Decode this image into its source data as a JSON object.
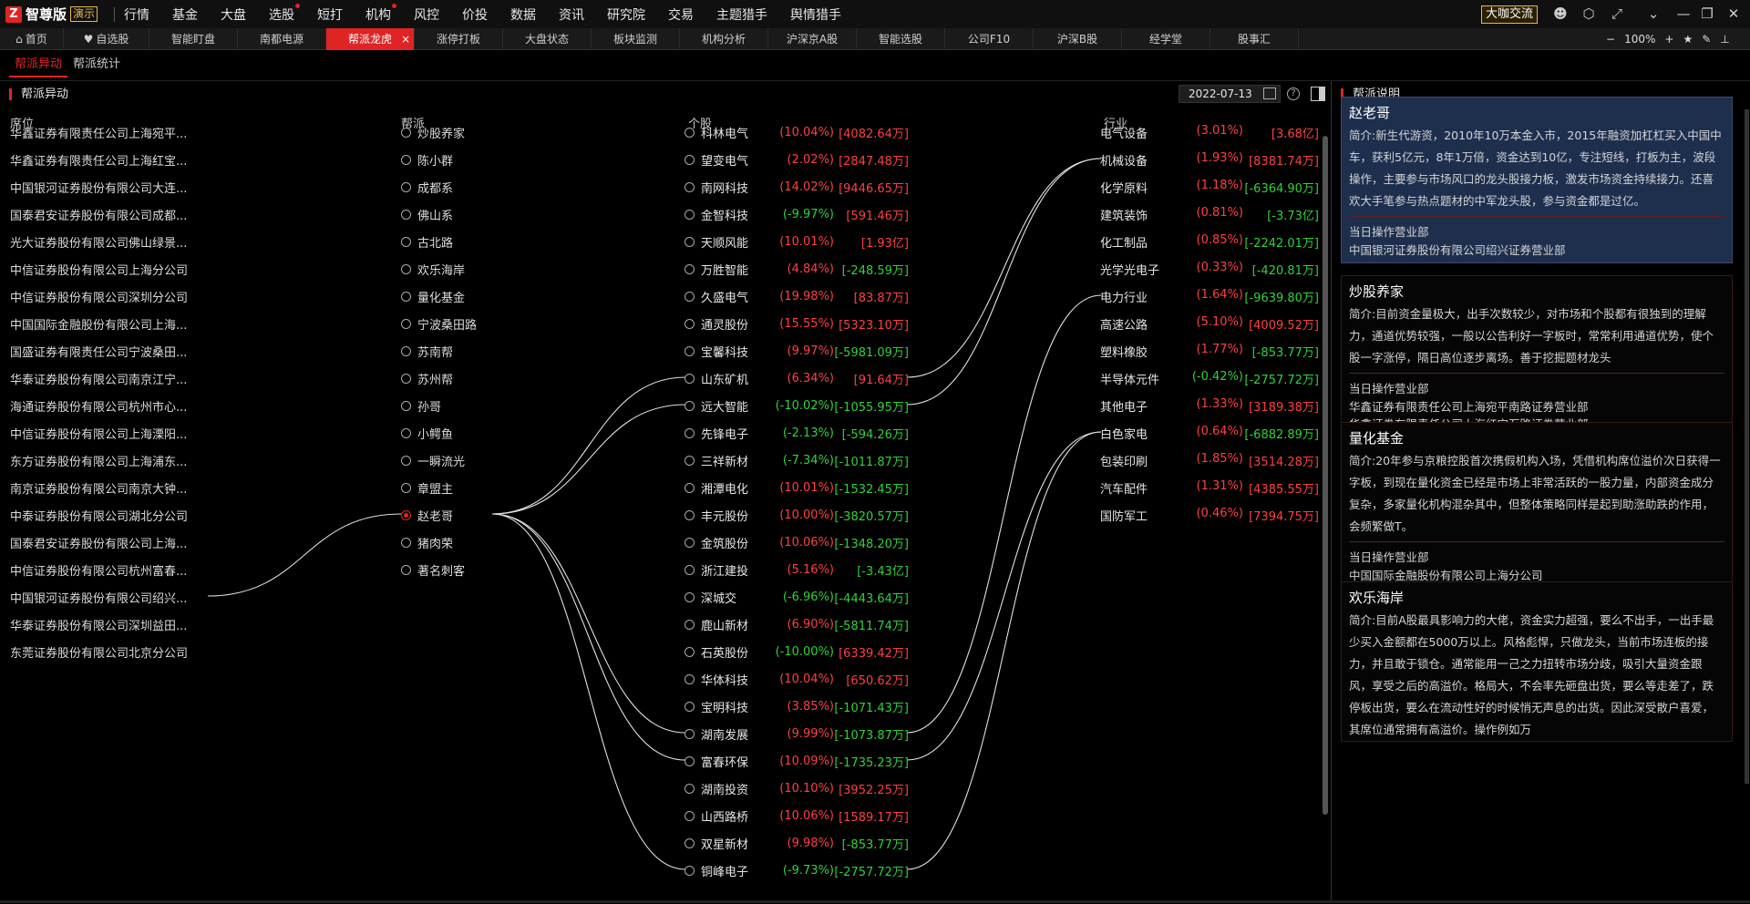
{
  "app": {
    "logo_mark": "Z",
    "name": "智尊版",
    "badge": "演示",
    "menus": [
      {
        "label": "行情",
        "dot": false
      },
      {
        "label": "基金",
        "dot": false
      },
      {
        "label": "大盘",
        "dot": false
      },
      {
        "label": "选股",
        "dot": true
      },
      {
        "label": "短打",
        "dot": false
      },
      {
        "label": "机构",
        "dot": true
      },
      {
        "label": "风控",
        "dot": false
      },
      {
        "label": "价投",
        "dot": false
      },
      {
        "label": "数据",
        "dot": false
      },
      {
        "label": "资讯",
        "dot": false
      },
      {
        "label": "研究院",
        "dot": false
      },
      {
        "label": "交易",
        "dot": false
      },
      {
        "label": "主题猎手",
        "dot": false
      },
      {
        "label": "舆情猎手",
        "dot": false
      }
    ],
    "daka_button": "大咖交流",
    "window_icons": [
      "user-icon",
      "settings-icon",
      "shrink-icon",
      "chevron-down-icon",
      "minimize-icon",
      "restore-icon",
      "close-icon"
    ]
  },
  "tabs": [
    {
      "label": "首页",
      "icon": "home-icon",
      "w": 118
    },
    {
      "label": "自选股",
      "icon": "heart-icon",
      "w": 118
    },
    {
      "label": "智能盯盘",
      "w": 118
    },
    {
      "label": "南都电源",
      "w": 118
    },
    {
      "label": "帮派龙虎",
      "active": true,
      "close": "×",
      "w": 118
    },
    {
      "label": "涨停打板",
      "w": 118
    },
    {
      "label": "大盘状态",
      "w": 118
    },
    {
      "label": "板块监测",
      "w": 118
    },
    {
      "label": "机构分析",
      "w": 118
    },
    {
      "label": "沪深京A股",
      "w": 118
    },
    {
      "label": "智能选股",
      "w": 118
    },
    {
      "label": "公司F10",
      "w": 118
    },
    {
      "label": "沪深B股",
      "w": 118
    },
    {
      "label": "经学堂",
      "w": 118
    },
    {
      "label": "股事汇",
      "w": 118
    }
  ],
  "zoom": {
    "minus": "−",
    "value": "100%",
    "plus": "+"
  },
  "subtabs": [
    {
      "label": "帮派异动",
      "active": true
    },
    {
      "label": "帮派统计",
      "active": false
    }
  ],
  "left_panel": {
    "title": "帮派异动",
    "date": "2022-07-13",
    "columns": {
      "seat": "席位",
      "gang": "帮派",
      "stock": "个股",
      "industry": "行业"
    },
    "seats": [
      "华鑫证券有限责任公司上海宛平...",
      "华鑫证券有限责任公司上海红宝...",
      "中国银河证券股份有限公司大连...",
      "国泰君安证券股份有限公司成都...",
      "光大证券股份有限公司佛山绿景...",
      "中信证券股份有限公司上海分公司",
      "中信证券股份有限公司深圳分公司",
      "中国国际金融股份有限公司上海...",
      "国盛证券有限责任公司宁波桑田...",
      "华泰证券股份有限公司南京江宁...",
      "海通证券股份有限公司杭州市心...",
      "中信证券股份有限公司上海溧阳...",
      "东方证券股份有限公司上海浦东...",
      "南京证券股份有限公司南京大钟...",
      "中泰证券股份有限公司湖北分公司",
      "国泰君安证券股份有限公司上海...",
      "中信证券股份有限公司杭州富春...",
      "中国银河证券股份有限公司绍兴...",
      "华泰证券股份有限公司深圳益田...",
      "东莞证券股份有限公司北京分公司"
    ],
    "gangs": [
      {
        "name": "炒股养家",
        "selected": false
      },
      {
        "name": "陈小群",
        "selected": false
      },
      {
        "name": "成都系",
        "selected": false
      },
      {
        "name": "佛山系",
        "selected": false
      },
      {
        "name": "古北路",
        "selected": false
      },
      {
        "name": "欢乐海岸",
        "selected": false
      },
      {
        "name": "量化基金",
        "selected": false
      },
      {
        "name": "宁波桑田路",
        "selected": false
      },
      {
        "name": "苏南帮",
        "selected": false
      },
      {
        "name": "苏州帮",
        "selected": false
      },
      {
        "name": "孙哥",
        "selected": false
      },
      {
        "name": "小鳄鱼",
        "selected": false
      },
      {
        "name": "一瞬流光",
        "selected": false
      },
      {
        "name": "章盟主",
        "selected": false
      },
      {
        "name": "赵老哥",
        "selected": true
      },
      {
        "name": "猪肉荣",
        "selected": false
      },
      {
        "name": "著名刺客",
        "selected": false
      }
    ],
    "stocks": [
      {
        "name": "科林电气",
        "pct": "(10.04%)",
        "amt": "[4082.64万]",
        "pct_up": true,
        "amt_up": true
      },
      {
        "name": "望变电气",
        "pct": "(2.02%)",
        "amt": "[2847.48万]",
        "pct_up": true,
        "amt_up": true
      },
      {
        "name": "南网科技",
        "pct": "(14.02%)",
        "amt": "[9446.65万]",
        "pct_up": true,
        "amt_up": true
      },
      {
        "name": "金智科技",
        "pct": "(-9.97%)",
        "amt": "[591.46万]",
        "pct_up": false,
        "amt_up": true
      },
      {
        "name": "天顺风能",
        "pct": "(10.01%)",
        "amt": "[1.93亿]",
        "pct_up": true,
        "amt_up": true
      },
      {
        "name": "万胜智能",
        "pct": "(4.84%)",
        "amt": "[-248.59万]",
        "pct_up": true,
        "amt_up": false
      },
      {
        "name": "久盛电气",
        "pct": "(19.98%)",
        "amt": "[83.87万]",
        "pct_up": true,
        "amt_up": true
      },
      {
        "name": "通灵股份",
        "pct": "(15.55%)",
        "amt": "[5323.10万]",
        "pct_up": true,
        "amt_up": true
      },
      {
        "name": "宝馨科技",
        "pct": "(9.97%)",
        "amt": "[-5981.09万]",
        "pct_up": true,
        "amt_up": false
      },
      {
        "name": "山东矿机",
        "pct": "(6.34%)",
        "amt": "[91.64万]",
        "pct_up": true,
        "amt_up": true
      },
      {
        "name": "远大智能",
        "pct": "(-10.02%)",
        "amt": "[-1055.95万]",
        "pct_up": false,
        "amt_up": false
      },
      {
        "name": "先锋电子",
        "pct": "(-2.13%)",
        "amt": "[-594.26万]",
        "pct_up": false,
        "amt_up": false
      },
      {
        "name": "三祥新材",
        "pct": "(-7.34%)",
        "amt": "[-1011.87万]",
        "pct_up": false,
        "amt_up": false
      },
      {
        "name": "湘潭电化",
        "pct": "(10.01%)",
        "amt": "[-1532.45万]",
        "pct_up": true,
        "amt_up": false
      },
      {
        "name": "丰元股份",
        "pct": "(10.00%)",
        "amt": "[-3820.57万]",
        "pct_up": true,
        "amt_up": false
      },
      {
        "name": "金筑股份",
        "pct": "(10.06%)",
        "amt": "[-1348.20万]",
        "pct_up": true,
        "amt_up": false
      },
      {
        "name": "浙江建投",
        "pct": "(5.16%)",
        "amt": "[-3.43亿]",
        "pct_up": true,
        "amt_up": false
      },
      {
        "name": "深城交",
        "pct": "(-6.96%)",
        "amt": "[-4443.64万]",
        "pct_up": false,
        "amt_up": false
      },
      {
        "name": "鹿山新材",
        "pct": "(6.90%)",
        "amt": "[-5811.74万]",
        "pct_up": true,
        "amt_up": false
      },
      {
        "name": "石英股份",
        "pct": "(-10.00%)",
        "amt": "[6339.42万]",
        "pct_up": false,
        "amt_up": true
      },
      {
        "name": "华体科技",
        "pct": "(10.04%)",
        "amt": "[650.62万]",
        "pct_up": true,
        "amt_up": true
      },
      {
        "name": "宝明科技",
        "pct": "(3.85%)",
        "amt": "[-1071.43万]",
        "pct_up": true,
        "amt_up": false
      },
      {
        "name": "湖南发展",
        "pct": "(9.99%)",
        "amt": "[-1073.87万]",
        "pct_up": true,
        "amt_up": false
      },
      {
        "name": "富春环保",
        "pct": "(10.09%)",
        "amt": "[-1735.23万]",
        "pct_up": true,
        "amt_up": false
      },
      {
        "name": "湖南投资",
        "pct": "(10.10%)",
        "amt": "[3952.25万]",
        "pct_up": true,
        "amt_up": true
      },
      {
        "name": "山西路桥",
        "pct": "(10.06%)",
        "amt": "[1589.17万]",
        "pct_up": true,
        "amt_up": true
      },
      {
        "name": "双星新材",
        "pct": "(9.98%)",
        "amt": "[-853.77万]",
        "pct_up": true,
        "amt_up": false
      },
      {
        "name": "铜峰电子",
        "pct": "(-9.73%)",
        "amt": "[-2757.72万]",
        "pct_up": false,
        "amt_up": false
      }
    ],
    "industries": [
      {
        "name": "电气设备",
        "pct": "(3.01%)",
        "amt": "[3.68亿]",
        "pct_up": true,
        "amt_up": true
      },
      {
        "name": "机械设备",
        "pct": "(1.93%)",
        "amt": "[8381.74万]",
        "pct_up": true,
        "amt_up": true
      },
      {
        "name": "化学原料",
        "pct": "(1.18%)",
        "amt": "[-6364.90万]",
        "pct_up": true,
        "amt_up": false
      },
      {
        "name": "建筑装饰",
        "pct": "(0.81%)",
        "amt": "[-3.73亿]",
        "pct_up": true,
        "amt_up": false
      },
      {
        "name": "化工制品",
        "pct": "(0.85%)",
        "amt": "[-2242.01万]",
        "pct_up": true,
        "amt_up": false
      },
      {
        "name": "光学光电子",
        "pct": "(0.33%)",
        "amt": "[-420.81万]",
        "pct_up": true,
        "amt_up": false
      },
      {
        "name": "电力行业",
        "pct": "(1.64%)",
        "amt": "[-9639.80万]",
        "pct_up": true,
        "amt_up": false
      },
      {
        "name": "高速公路",
        "pct": "(5.10%)",
        "amt": "[4009.52万]",
        "pct_up": true,
        "amt_up": true
      },
      {
        "name": "塑料橡胶",
        "pct": "(1.77%)",
        "amt": "[-853.77万]",
        "pct_up": true,
        "amt_up": false
      },
      {
        "name": "半导体元件",
        "pct": "(-0.42%)",
        "amt": "[-2757.72万]",
        "pct_up": false,
        "amt_up": false
      },
      {
        "name": "其他电子",
        "pct": "(1.33%)",
        "amt": "[3189.38万]",
        "pct_up": true,
        "amt_up": true
      },
      {
        "name": "白色家电",
        "pct": "(0.64%)",
        "amt": "[-6882.89万]",
        "pct_up": true,
        "amt_up": false
      },
      {
        "name": "包装印刷",
        "pct": "(1.85%)",
        "amt": "[3514.28万]",
        "pct_up": true,
        "amt_up": true
      },
      {
        "name": "汽车配件",
        "pct": "(1.31%)",
        "amt": "[4385.55万]",
        "pct_up": true,
        "amt_up": true
      },
      {
        "name": "国防军工",
        "pct": "(0.46%)",
        "amt": "[7394.75万]",
        "pct_up": true,
        "amt_up": true
      }
    ],
    "links": {
      "seat_to_gang": [
        [
          17,
          14
        ]
      ],
      "gang_to_stock": [
        [
          14,
          9
        ],
        [
          14,
          10
        ],
        [
          14,
          22
        ],
        [
          14,
          23
        ],
        [
          14,
          27
        ]
      ],
      "stock_to_industry": [
        [
          9,
          1
        ],
        [
          10,
          1
        ],
        [
          22,
          6
        ],
        [
          23,
          11
        ],
        [
          27,
          11
        ]
      ]
    }
  },
  "right_panel": {
    "title": "帮派说明",
    "op_label": "当日操作营业部",
    "cards": [
      {
        "name": "赵老哥",
        "selected": true,
        "desc": "简介:新生代游资，2010年10万本金入市，2015年融资加杠杠买入中国中车，获利5亿元，8年1万倍，资金达到10亿，专注短线，打板为主，波段操作，主要参与市场风口的龙头股接力板，激发市场资金持续接力。还喜欢大手笔参与热点题材的中军龙头股，参与资金都是过亿。",
        "branches": [
          "中国银河证券股份有限公司绍兴证券营业部"
        ]
      },
      {
        "name": "炒股养家",
        "selected": false,
        "desc": "简介:目前资金量极大，出手次数较少，对市场和个股都有很独到的理解力，通道优势较强，一般以公告利好一字板时，常常利用通道优势，使个股一字涨停，隔日高位逐步离场。善于挖掘题材龙头",
        "branches": [
          "华鑫证券有限责任公司上海宛平南路证券营业部",
          "华鑫证券有限责任公司上海红宝石路证券营业部"
        ]
      },
      {
        "name": "量化基金",
        "selected": false,
        "desc": "简介:20年参与京粮控股首次携假机构入场，凭借机构席位溢价次日获得一字板，到现在量化资金已经是市场上非常活跃的一股力量，内部资金成分复杂，多家量化机构混杂其中，但整体策略同样是起到助涨助跌的作用，会频繁做T。",
        "branches": [
          "中国国际金融股份有限公司上海分公司"
        ]
      },
      {
        "name": "欢乐海岸",
        "selected": false,
        "desc": "简介:目前A股最具影响力的大佬，资金实力超强，要么不出手，一出手最少买入金额都在5000万以上。风格彪悍，只做龙头，当前市场连板的接力，并且敢于锁仓。通常能用一己之力扭转市场分歧，吸引大量资金跟风，享受之后的高溢价。格局大，不会率先砸盘出货，要么等走差了，跌停板出货，要么在流动性好的时候悄无声息的出货。因此深受散户喜爱，其席位通常拥有高溢价。操作例如万",
        "branches": []
      }
    ]
  },
  "colors": {
    "accent": "#e02424",
    "up": "#ff4040",
    "down": "#2fd23a",
    "gold": "#e8b84a",
    "selected_card": "#1e2f4e"
  }
}
